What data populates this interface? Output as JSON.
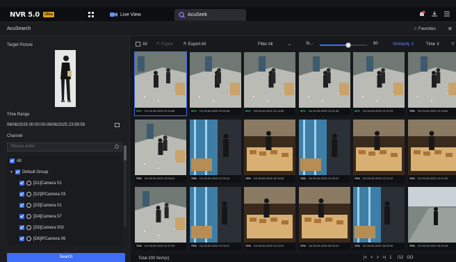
{
  "topbar": {
    "brand": "NVR 5.0",
    "brand_badge": "Ultra",
    "tabs": [
      {
        "label": "Live View"
      },
      {
        "label": "AcuSeek"
      }
    ]
  },
  "page": {
    "title": "AcuSearch",
    "favorites_label": "Favorites",
    "close_label": "✕"
  },
  "left": {
    "target_picture_label": "Target Picture",
    "time_range_label": "Time Range",
    "time_range_value": "06/06/2025 00:00:00-06/06/2025 23:59:59",
    "channel_label": "Channel",
    "search_placeholder": "Please enter",
    "tree": {
      "all_label": "All",
      "group_label": "Default Group",
      "cameras": [
        "[D1]Camera 01",
        "[D2]IPCamera 03",
        "[D3]Camera 01",
        "[D4]Camera 07",
        "[D5]Camera 002",
        "[D6]IPCamera 06"
      ]
    },
    "search_button": "Search"
  },
  "toolbar": {
    "all_label": "All",
    "export_label": "Export",
    "export_all_label": "Export All",
    "filter_label": "Filter",
    "filter_value": "All",
    "similarity_short": "Si...",
    "similarity_value": 60,
    "similarity_value_text": "60",
    "similarity_max": 100,
    "sort_similarity_label": "Similarity",
    "sort_time_label": "Time"
  },
  "results": [
    {
      "pct": "90%",
      "time": "D4 06-06-2025 12:14:46",
      "scene": "lobby"
    },
    {
      "pct": "80%",
      "time": "D4 06-06-2025 12:30:36",
      "scene": "lobby"
    },
    {
      "pct": "80%",
      "time": "D5 06-06-2025 12:14:56",
      "scene": "lobby"
    },
    {
      "pct": "80%",
      "time": "D4 06-06-2025 12:31:36",
      "scene": "lobby"
    },
    {
      "pct": "80%",
      "time": "D4 06-06-2025 12:31:33",
      "scene": "lobby"
    },
    {
      "pct": "79%",
      "time": "D4 06-06-2025 12:18:55",
      "scene": "lobby"
    },
    {
      "pct": "79%",
      "time": "D4 06-06-2025 10:06:51",
      "scene": "lobby"
    },
    {
      "pct": "74%",
      "time": "D4 06-06-2025 12:32:42",
      "scene": "glass"
    },
    {
      "pct": "74%",
      "time": "D4 06-06-2025 10:00:53",
      "scene": "bakery"
    },
    {
      "pct": "74%",
      "time": "D4 06-06-2025 12:30:47",
      "scene": "glass"
    },
    {
      "pct": "72%",
      "time": "D4 06-06-2025 12:12:10",
      "scene": "bakery"
    },
    {
      "pct": "72%",
      "time": "D4 06-06-2025 12:01:35",
      "scene": "bakery"
    },
    {
      "pct": "71%",
      "time": "D4 06-06-2025 12:37:20",
      "scene": "lobby"
    },
    {
      "pct": "71%",
      "time": "D4 06-06-2025 12:32:47",
      "scene": "glass"
    },
    {
      "pct": "71%",
      "time": "D4 06-06-2025 12:12:57",
      "scene": "bakery"
    },
    {
      "pct": "71%",
      "time": "D4 06-06-2025 00:00:14",
      "scene": "bakery"
    },
    {
      "pct": "71%",
      "time": "D4 06-06-2025 16:25:46",
      "scene": "glass"
    },
    {
      "pct": "70%",
      "time": "D4 06-06-2025 16:20:46",
      "scene": "street"
    }
  ],
  "status": {
    "total": "Total 200 Item(s)",
    "page_current": "1",
    "page_total": "/12",
    "go_label": "GO"
  },
  "colors": {
    "accent": "#3d6ef5",
    "match_green": "#39c16c",
    "brand_badge": "#d8a21e"
  }
}
